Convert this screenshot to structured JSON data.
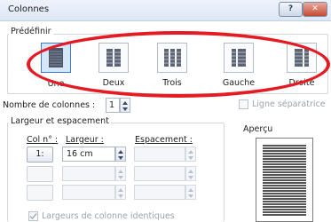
{
  "dialog": {
    "title": "Colonnes",
    "help_label": "?",
    "close_label": "✕"
  },
  "predefinir": {
    "heading": "Prédéfinir",
    "presets": [
      {
        "label": "Une",
        "selected": true
      },
      {
        "label": "Deux",
        "selected": false
      },
      {
        "label": "Trois",
        "selected": false
      },
      {
        "label": "Gauche",
        "selected": false
      },
      {
        "label": "Droite",
        "selected": false
      }
    ]
  },
  "colonnes": {
    "label": "Nombre de colonnes :",
    "value": "1"
  },
  "ligne_separatrice": {
    "label": "Ligne séparatrice",
    "checked": false,
    "enabled": false
  },
  "largeur_espacement": {
    "heading": "Largeur et espacement",
    "col_header": "Col n° :",
    "largeur_header": "Largeur :",
    "espacement_header": "Espacement :",
    "rows": [
      {
        "col": "1:",
        "largeur": "16 cm",
        "espacement": ""
      },
      {
        "col": "",
        "largeur": "",
        "espacement": ""
      },
      {
        "col": "",
        "largeur": "",
        "espacement": ""
      }
    ]
  },
  "identiques": {
    "label": "Largeurs de colonne identiques",
    "checked": true,
    "enabled": false
  },
  "apercu": {
    "heading": "Aperçu"
  },
  "annotation": {
    "color": "#e51b24"
  }
}
